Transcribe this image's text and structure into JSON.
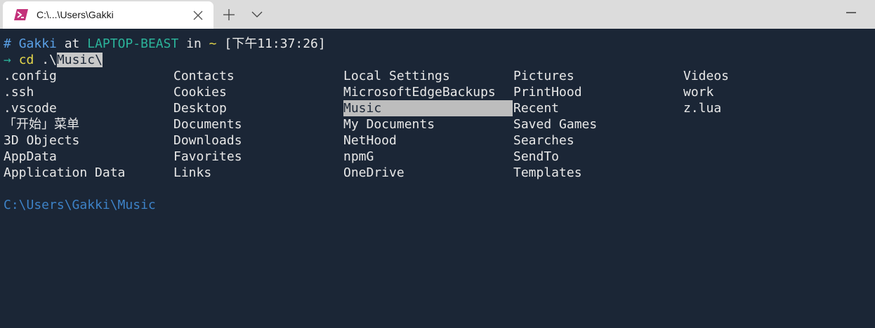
{
  "tab": {
    "title": "C:\\...\\Users\\Gakki"
  },
  "prompt": {
    "hash": "#",
    "user": "Gakki",
    "at": "at",
    "host": "LAPTOP-BEAST",
    "in": "in",
    "dir": "~",
    "time": "[下午11:37:26]"
  },
  "command": {
    "arrow": "→",
    "cmd": "cd",
    "arg_prefix": ".\\",
    "arg_completion": "Music\\"
  },
  "completions": {
    "columns": [
      [
        ".config",
        ".ssh",
        ".vscode",
        "「开始」菜单",
        "3D Objects",
        "AppData",
        "Application Data"
      ],
      [
        "Contacts",
        "Cookies",
        "Desktop",
        "Documents",
        "Downloads",
        "Favorites",
        "Links"
      ],
      [
        "Local Settings",
        "MicrosoftEdgeBackups",
        "Music",
        "My Documents",
        "NetHood",
        "npmG",
        "OneDrive"
      ],
      [
        "Pictures",
        "PrintHood",
        "Recent",
        "Saved Games",
        "Searches",
        "SendTo",
        "Templates"
      ],
      [
        "Videos",
        "work",
        "z.lua"
      ]
    ],
    "selected": "Music"
  },
  "cwd": "C:\\Users\\Gakki\\Music",
  "colors": {
    "background": "#1b2636",
    "titlebar": "#dcdcdc",
    "blue": "#5aa0e6",
    "teal": "#2bb39a",
    "yellow": "#e6d84a",
    "highlight": "#bdbdbd"
  },
  "icons": {
    "tab": "powershell-icon",
    "close": "close-icon",
    "new_tab": "plus-icon",
    "dropdown": "chevron-down-icon",
    "minimize": "minimize-icon"
  }
}
